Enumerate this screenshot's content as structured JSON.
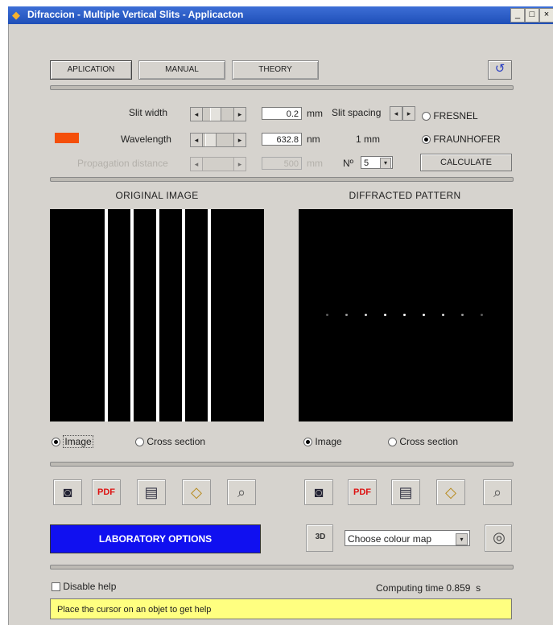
{
  "window": {
    "title": "Difraccion - Multiple Vertical Slits - Applicacton",
    "minimize_label": "_",
    "maximize_label": "□",
    "close_label": "×"
  },
  "tabs": [
    {
      "label": "APLICATION"
    },
    {
      "label": "MANUAL"
    },
    {
      "label": "THEORY"
    }
  ],
  "controls": {
    "slit_width_label": "Slit width",
    "slit_width_value": "0.2",
    "slit_width_unit": "mm",
    "slit_spacing_label": "Slit spacing",
    "wavelength_label": "Wavelength",
    "wavelength_value": "632.8",
    "wavelength_unit": "nm",
    "spacing_value": "1 mm",
    "disabled_label": "Propagation distance",
    "disabled_value": "500",
    "disabled_unit": "mm",
    "n_label": "Nº",
    "n_value": "5",
    "fresnel_label": "FRESNEL",
    "fraunhofer_label": "FRAUNHOFER",
    "calculate_label": "CALCULATE",
    "wavelength_color": "#f44f0a",
    "selected_mode": "FRAUNHOFER"
  },
  "original": {
    "heading": "ORIGINAL IMAGE",
    "image_radio": "Image",
    "cross_radio": "Cross section",
    "selected": "Image",
    "slit_count": 5
  },
  "diffracted": {
    "heading": "DIFFRACTED PATTERN",
    "image_radio": "Image",
    "cross_radio": "Cross section",
    "selected": "Image"
  },
  "toolbar_icons": [
    "camera-icon",
    "pdf-icon",
    "printer-icon",
    "notepad-icon",
    "zoom-icon"
  ],
  "lab": {
    "button_label": "LABORATORY OPTIONS",
    "button_color": "#1010f0",
    "colormap_placeholder": "Choose colour map",
    "zoom_3d_label": "3D"
  },
  "footer": {
    "disable_help_label": "Disable help",
    "computing_label": "Computing time",
    "computing_value": "0.859",
    "computing_unit": "s",
    "help_text": "Place the cursor on an objet to get help",
    "help_bg": "#ffff80"
  }
}
